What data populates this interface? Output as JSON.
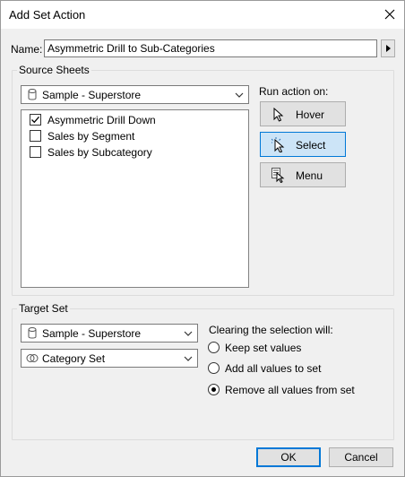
{
  "window": {
    "title": "Add Set Action"
  },
  "name_field": {
    "label": "Name:",
    "value": "Asymmetric Drill to Sub-Categories"
  },
  "source_sheets": {
    "group_label": "Source Sheets",
    "data_source": {
      "value": "Sample - Superstore",
      "icon": "database-icon"
    },
    "sheets": [
      {
        "label": "Asymmetric Drill Down",
        "checked": true
      },
      {
        "label": "Sales by Segment",
        "checked": false
      },
      {
        "label": "Sales by Subcategory",
        "checked": false
      }
    ],
    "run_action_label": "Run action on:",
    "actions": [
      {
        "label": "Hover",
        "icon": "pointer-icon",
        "selected": false
      },
      {
        "label": "Select",
        "icon": "click-pointer-icon",
        "selected": true
      },
      {
        "label": "Menu",
        "icon": "menu-pointer-icon",
        "selected": false
      }
    ]
  },
  "target_set": {
    "group_label": "Target Set",
    "data_source": {
      "value": "Sample - Superstore",
      "icon": "database-icon"
    },
    "set": {
      "value": "Category Set",
      "icon": "set-icon"
    },
    "clearing_label": "Clearing the selection will:",
    "options": [
      {
        "label": "Keep set values",
        "selected": false
      },
      {
        "label": "Add all values to set",
        "selected": false
      },
      {
        "label": "Remove all values from set",
        "selected": true
      }
    ]
  },
  "footer": {
    "ok_label": "OK",
    "cancel_label": "Cancel"
  }
}
